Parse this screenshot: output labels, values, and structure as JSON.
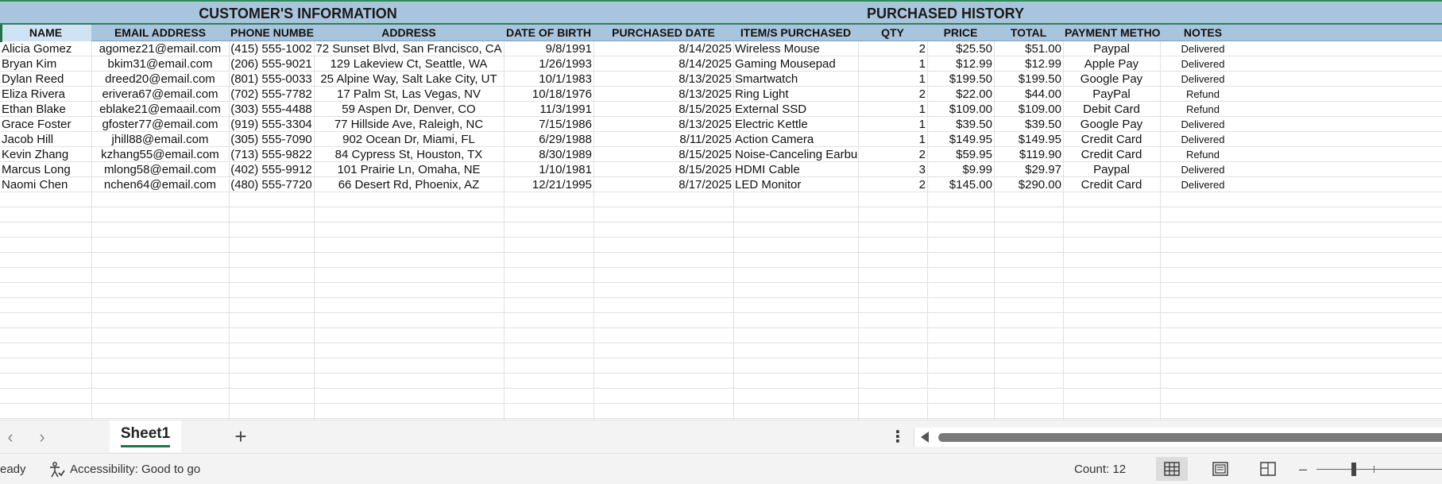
{
  "sections": {
    "customer": "CUSTOMER'S INFORMATION",
    "purchase": "PURCHASED HISTORY"
  },
  "columns": [
    "NAME",
    "EMAIL ADDRESS",
    "PHONE NUMBER",
    "ADDRESS",
    "DATE OF BIRTH",
    "PURCHASED DATE",
    "ITEM/S PURCHASED",
    "QTY",
    "PRICE",
    "TOTAL",
    "PAYMENT METHOD",
    "NOTES"
  ],
  "rows": [
    [
      "Alicia Gomez",
      "agomez21@email.com",
      "(415) 555-1002",
      "72 Sunset Blvd, San Francisco, CA",
      "9/8/1991",
      "8/14/2025",
      "Wireless Mouse",
      "2",
      "$25.50",
      "$51.00",
      "Paypal",
      "Delivered"
    ],
    [
      "Bryan Kim",
      "bkim31@email.com",
      "(206) 555-9021",
      "129 Lakeview Ct, Seattle, WA",
      "1/26/1993",
      "8/14/2025",
      "Gaming Mousepad",
      "1",
      "$12.99",
      "$12.99",
      "Apple Pay",
      "Delivered"
    ],
    [
      "Dylan Reed",
      "dreed20@email.com",
      "(801) 555-0033",
      "25 Alpine Way, Salt Lake City, UT",
      "10/1/1983",
      "8/13/2025",
      "Smartwatch",
      "1",
      "$199.50",
      "$199.50",
      "Google Pay",
      "Delivered"
    ],
    [
      "Eliza Rivera",
      "erivera67@email.com",
      "(702) 555-7782",
      "17 Palm St, Las Vegas, NV",
      "10/18/1976",
      "8/13/2025",
      "Ring Light",
      "2",
      "$22.00",
      "$44.00",
      "PayPal",
      "Refund"
    ],
    [
      "Ethan Blake",
      "eblake21@emaail.com",
      "(303) 555-4488",
      "59 Aspen Dr, Denver, CO",
      "11/3/1991",
      "8/15/2025",
      "External SSD",
      "1",
      "$109.00",
      "$109.00",
      "Debit Card",
      "Refund"
    ],
    [
      "Grace Foster",
      "gfoster77@email.com",
      "(919) 555-3304",
      "77 Hillside Ave, Raleigh, NC",
      "7/15/1986",
      "8/13/2025",
      "Electric Kettle",
      "1",
      "$39.50",
      "$39.50",
      "Google Pay",
      "Delivered"
    ],
    [
      "Jacob Hill",
      "jhill88@email.com",
      "(305) 555-7090",
      "902 Ocean Dr, Miami, FL",
      "6/29/1988",
      "8/11/2025",
      "Action Camera",
      "1",
      "$149.95",
      "$149.95",
      "Credit Card",
      "Delivered"
    ],
    [
      "Kevin Zhang",
      "kzhang55@email.com",
      "(713) 555-9822",
      "84 Cypress St, Houston, TX",
      "8/30/1989",
      "8/15/2025",
      "Noise-Canceling Earbuc",
      "2",
      "$59.95",
      "$119.90",
      "Credit Card",
      "Refund"
    ],
    [
      "Marcus Long",
      "mlong58@email.com",
      "(402) 555-9912",
      "101 Prairie Ln, Omaha, NE",
      "1/10/1981",
      "8/15/2025",
      "HDMI Cable",
      "3",
      "$9.99",
      "$29.97",
      "Paypal",
      "Delivered"
    ],
    [
      "Naomi Chen",
      "nchen64@email.com",
      "(480) 555-7720",
      "66 Desert Rd, Phoenix, AZ",
      "12/21/1995",
      "8/17/2025",
      "LED Monitor",
      "2",
      "$145.00",
      "$290.00",
      "Credit Card",
      "Delivered"
    ]
  ],
  "tabs": {
    "sheet_name": "Sheet1",
    "add_label": "+",
    "more_label": "⋮",
    "prev_label": "‹",
    "next_label": "›"
  },
  "status": {
    "ready": "eady",
    "accessibility": "Accessibility: Good to go",
    "count": "Count: 12",
    "zoom_minus": "–"
  },
  "icons": {
    "accessibility": "accessibility-icon",
    "normal_view": "grid-view-icon",
    "page_layout": "page-layout-icon",
    "page_break": "page-break-preview-icon"
  },
  "colors": {
    "header_bg": "#a9c5dd",
    "selected_header": "#cfe3f5",
    "accent": "#217346"
  }
}
